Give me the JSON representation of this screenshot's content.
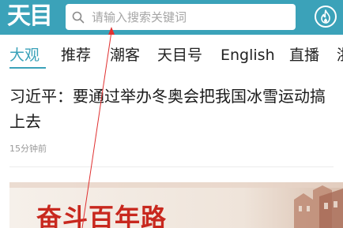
{
  "header": {
    "logo_text": "天目",
    "search_placeholder": "请输入搜索关键词",
    "hot_icon": "flame-icon",
    "accent_color": "#3ba2b9"
  },
  "tabs": [
    {
      "label": "大观",
      "active": true
    },
    {
      "label": "推荐"
    },
    {
      "label": "潮客"
    },
    {
      "label": "天目号"
    },
    {
      "label": "English"
    },
    {
      "label": "直播"
    },
    {
      "label": "浙"
    }
  ],
  "article": {
    "title": "习近平：要通过举办冬奥会把我国冰雪运动搞上去",
    "time": "15分钟前"
  },
  "banner": {
    "text": "奋斗百年路"
  }
}
